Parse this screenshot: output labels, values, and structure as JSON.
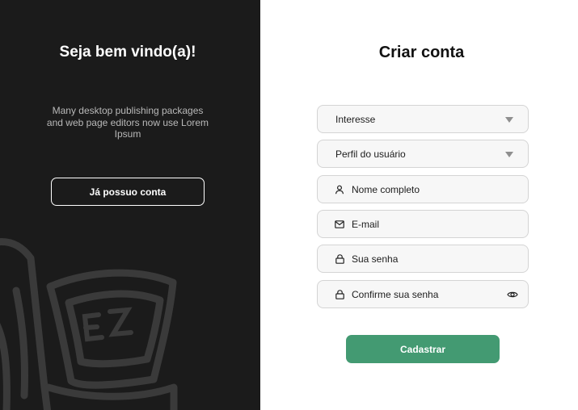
{
  "welcome": {
    "title": "Seja bem vindo(a)!",
    "description": "Many desktop publishing packages and web page editors now use Lorem Ipsum",
    "login_button": "Já possuo conta"
  },
  "form": {
    "title": "Criar conta",
    "fields": {
      "interest": "Interesse",
      "profile": "Perfil do usuário",
      "name": "Nome completo",
      "email": "E-mail",
      "password": "Sua senha",
      "confirm_password": "Confirme sua senha"
    },
    "submit": "Cadastrar"
  },
  "colors": {
    "left_bg": "#1b1b1b",
    "accent": "#439a72",
    "field_bg": "#f7f7f7",
    "field_border": "#d4d4d4"
  },
  "logo_text": "EZ"
}
